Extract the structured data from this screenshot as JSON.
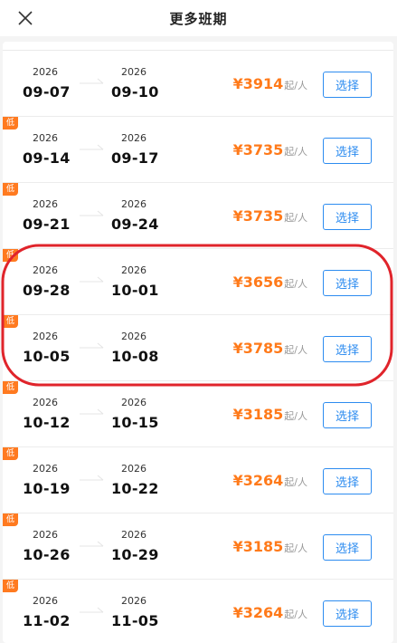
{
  "header": {
    "title": "更多班期",
    "close_icon": "close-icon"
  },
  "colors": {
    "accent": "#ff7a1a",
    "button": "#2d8cf0",
    "badge": "#ff7a20",
    "annotation": "#e0242b"
  },
  "departures": [
    {
      "low": false,
      "dep_year": "2026",
      "dep_date": "09-07",
      "ret_year": "2026",
      "ret_date": "09-10",
      "price": "¥3914",
      "unit": "起/人",
      "button": "选择"
    },
    {
      "low": true,
      "badge": "低",
      "dep_year": "2026",
      "dep_date": "09-14",
      "ret_year": "2026",
      "ret_date": "09-17",
      "price": "¥3735",
      "unit": "起/人",
      "button": "选择"
    },
    {
      "low": true,
      "badge": "低",
      "dep_year": "2026",
      "dep_date": "09-21",
      "ret_year": "2026",
      "ret_date": "09-24",
      "price": "¥3735",
      "unit": "起/人",
      "button": "选择"
    },
    {
      "low": true,
      "badge": "低",
      "dep_year": "2026",
      "dep_date": "09-28",
      "ret_year": "2026",
      "ret_date": "10-01",
      "price": "¥3656",
      "unit": "起/人",
      "button": "选择"
    },
    {
      "low": true,
      "badge": "低",
      "dep_year": "2026",
      "dep_date": "10-05",
      "ret_year": "2026",
      "ret_date": "10-08",
      "price": "¥3785",
      "unit": "起/人",
      "button": "选择"
    },
    {
      "low": true,
      "badge": "低",
      "dep_year": "2026",
      "dep_date": "10-12",
      "ret_year": "2026",
      "ret_date": "10-15",
      "price": "¥3185",
      "unit": "起/人",
      "button": "选择"
    },
    {
      "low": true,
      "badge": "低",
      "dep_year": "2026",
      "dep_date": "10-19",
      "ret_year": "2026",
      "ret_date": "10-22",
      "price": "¥3264",
      "unit": "起/人",
      "button": "选择"
    },
    {
      "low": true,
      "badge": "低",
      "dep_year": "2026",
      "dep_date": "10-26",
      "ret_year": "2026",
      "ret_date": "10-29",
      "price": "¥3185",
      "unit": "起/人",
      "button": "选择"
    },
    {
      "low": true,
      "badge": "低",
      "dep_year": "2026",
      "dep_date": "11-02",
      "ret_year": "2026",
      "ret_date": "11-05",
      "price": "¥3264",
      "unit": "起/人",
      "button": "选择"
    }
  ]
}
